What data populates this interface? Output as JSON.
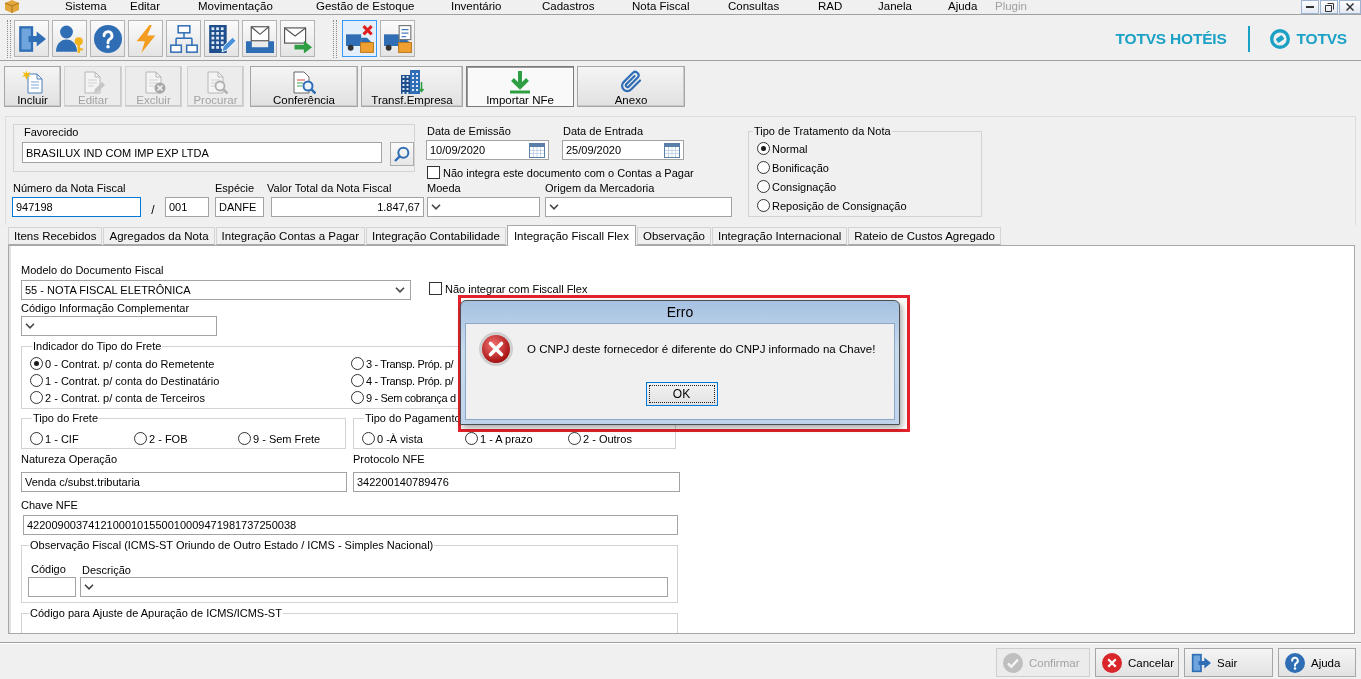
{
  "menu_bar": {
    "items": [
      {
        "label": "Sistema",
        "disabled": false
      },
      {
        "label": "Editar",
        "disabled": false
      },
      {
        "label": "Movimentação",
        "disabled": false
      },
      {
        "label": "Gestão de Estoque",
        "disabled": false
      },
      {
        "label": "Inventário",
        "disabled": false
      },
      {
        "label": "Cadastros",
        "disabled": false
      },
      {
        "label": "Nota Fiscal",
        "disabled": false
      },
      {
        "label": "Consultas",
        "disabled": false
      },
      {
        "label": "RAD",
        "disabled": false
      },
      {
        "label": "Janela",
        "disabled": false
      },
      {
        "label": "Ajuda",
        "disabled": false
      },
      {
        "label": "Plugin",
        "disabled": true
      }
    ]
  },
  "toolbar": {
    "groups": [
      {
        "buttons": [
          {
            "selected": false
          },
          {
            "selected": false
          },
          {
            "selected": false
          },
          {
            "selected": false
          },
          {
            "selected": false
          },
          {
            "selected": false
          },
          {
            "selected": false
          },
          {
            "selected": false
          }
        ]
      },
      {
        "buttons": [
          {
            "selected": true
          },
          {
            "selected": false
          }
        ]
      }
    ]
  },
  "brand": {
    "product": "TOTVS HOTÉIS",
    "company": "TOTVS"
  },
  "action_bar": {
    "buttons": [
      {
        "label": "Incluir",
        "disabled": false,
        "pressed": false
      },
      {
        "label": "Editar",
        "disabled": true,
        "pressed": false
      },
      {
        "label": "Excluir",
        "disabled": true,
        "pressed": false
      },
      {
        "label": "Procurar",
        "disabled": true,
        "pressed": false
      },
      {
        "label": "Conferência",
        "disabled": false,
        "pressed": false
      },
      {
        "label": "Transf.Empresa",
        "disabled": false,
        "pressed": false
      },
      {
        "label": "Importar NFe",
        "disabled": false,
        "pressed": true
      },
      {
        "label": "Anexo",
        "disabled": false,
        "pressed": false
      }
    ]
  },
  "header": {
    "favorecido": {
      "label": "Favorecido",
      "value": "BRASILUX IND COM IMP EXP LTDA"
    },
    "data_emissao": {
      "label": "Data de Emissão",
      "value": "10/09/2020"
    },
    "data_entrada": {
      "label": "Data de Entrada",
      "value": "25/09/2020"
    },
    "nao_integra_contas_pagar": {
      "label": "Não integra este documento com o Contas a Pagar",
      "checked": false
    },
    "numero_nota": {
      "label": "Número da Nota Fiscal",
      "value": "947198",
      "focused": true
    },
    "separator": "/",
    "serie": {
      "value": "001"
    },
    "especie": {
      "label": "Espécie",
      "value": "DANFE"
    },
    "valor_total": {
      "label": "Valor Total da Nota Fiscal",
      "value": "1.847,67"
    },
    "moeda": {
      "label": "Moeda"
    },
    "origem_mercadoria": {
      "label": "Origem da Mercadoria"
    },
    "tipo_tratamento": {
      "title": "Tipo de Tratamento da Nota",
      "options": [
        {
          "label": "Normal",
          "selected": true
        },
        {
          "label": "Bonificação",
          "selected": false
        },
        {
          "label": "Consignação",
          "selected": false
        },
        {
          "label": "Reposição de Consignação",
          "selected": false
        }
      ]
    }
  },
  "tabs": [
    {
      "label": "Itens Recebidos",
      "selected": false
    },
    {
      "label": "Agregados da Nota",
      "selected": false
    },
    {
      "label": "Integração Contas a Pagar",
      "selected": false
    },
    {
      "label": "Integração Contabilidade",
      "selected": false
    },
    {
      "label": "Integração Fiscall Flex",
      "selected": true
    },
    {
      "label": "Observação",
      "selected": false
    },
    {
      "label": "Integração Internacional",
      "selected": false
    },
    {
      "label": "Rateio de Custos Agregado",
      "selected": false
    }
  ],
  "fiscal_flex": {
    "modelo_documento": {
      "label": "Modelo do Documento Fiscal",
      "value": "55 - NOTA FISCAL ELETRÔNICA"
    },
    "nao_integrar": {
      "label": "Não integrar com Fiscall Flex",
      "checked": false
    },
    "codigo_info_complementar": {
      "label": "Código Informação Complementar"
    },
    "indicador_frete": {
      "title": "Indicador do Tipo do Frete",
      "options": [
        {
          "label": "0 - Contrat. p/ conta do Remetente",
          "selected": true
        },
        {
          "label": "1 - Contrat. p/ conta do Destinatário",
          "selected": false
        },
        {
          "label": "2 - Contrat. p/ conta de Terceiros",
          "selected": false
        },
        {
          "label": "3 - Transp. Próp. p/",
          "selected": false
        },
        {
          "label": "4 - Transp. Próp. p/",
          "selected": false
        },
        {
          "label": "9 - Sem cobrança d",
          "selected": false
        }
      ]
    },
    "tipo_frete": {
      "title": "Tipo do Frete",
      "options": [
        {
          "label": "1 - CIF",
          "selected": false
        },
        {
          "label": "2 - FOB",
          "selected": false
        },
        {
          "label": "9 - Sem Frete",
          "selected": false
        }
      ]
    },
    "tipo_pagamento": {
      "title": "Tipo do Pagamento",
      "options": [
        {
          "label": "0 -À vista",
          "selected": false
        },
        {
          "label": "1 - A prazo",
          "selected": false
        },
        {
          "label": "2 - Outros",
          "selected": false
        }
      ]
    },
    "natureza_operacao": {
      "label": "Natureza Operação",
      "value": "Venda c/subst.tributaria"
    },
    "protocolo_nfe": {
      "label": "Protocolo NFE",
      "value": "342200140789476"
    },
    "chave_nfe": {
      "label": "Chave NFE",
      "value": "42200900374121000101550010009471981737250038"
    },
    "observacao_fiscal": {
      "title": "Observação Fiscal (ICMS-ST Oriundo de Outro Estado / ICMS - Simples Nacional)",
      "codigo_label": "Código",
      "descricao_label": "Descrição"
    },
    "ajuste_apuracao": {
      "title": "Código para Ajuste de Apuração de ICMS/ICMS-ST"
    }
  },
  "footer_buttons": [
    {
      "label": "Confirmar",
      "disabled": true
    },
    {
      "label": "Cancelar",
      "disabled": false
    },
    {
      "label": "Sair",
      "disabled": false
    },
    {
      "label": "Ajuda",
      "disabled": false
    }
  ],
  "dialog": {
    "title": "Erro",
    "message": "O CNPJ deste fornecedor é diferente do CNPJ informado na Chave!",
    "button": {
      "label": "OK",
      "focused": true
    }
  }
}
